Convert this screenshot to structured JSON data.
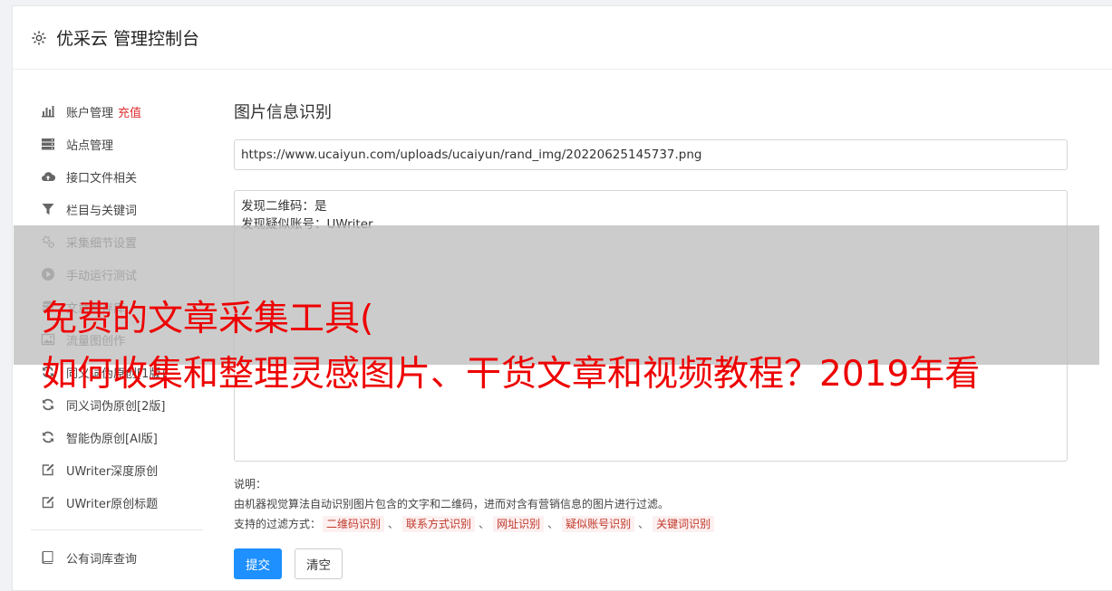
{
  "header": {
    "title": "优采云 管理控制台",
    "icon": "gear-icon"
  },
  "sidebar": {
    "items": [
      {
        "icon": "bar-chart-icon",
        "label": "账户管理",
        "badge": "充值"
      },
      {
        "icon": "server-icon",
        "label": "站点管理"
      },
      {
        "icon": "cloud-upload-icon",
        "label": "接口文件相关"
      },
      {
        "icon": "filter-icon",
        "label": "栏目与关键词"
      },
      {
        "icon": "cogs-icon",
        "label": "采集细节设置"
      },
      {
        "icon": "play-circle-icon",
        "label": "手动运行测试"
      },
      {
        "icon": "database-icon",
        "label": "文章暂存库"
      },
      {
        "icon": "image-icon",
        "label": "流量图创作"
      },
      {
        "icon": "refresh-icon",
        "label": "同义词伪原创[1版]"
      },
      {
        "icon": "refresh-icon",
        "label": "同义词伪原创[2版]"
      },
      {
        "icon": "refresh-icon",
        "label": "智能伪原创[AI版]"
      },
      {
        "icon": "edit-icon",
        "label": "UWriter深度原创"
      },
      {
        "icon": "edit-icon",
        "label": "UWriter原创标题"
      }
    ],
    "footer_items": [
      {
        "icon": "book-icon",
        "label": "公有词库查询"
      }
    ]
  },
  "main": {
    "title": "图片信息识别",
    "url_value": "https://www.ucaiyun.com/uploads/ucaiyun/rand_img/20220625145737.png",
    "result_lines": [
      "发现二维码：是",
      "发现疑似账号：UWriter"
    ],
    "note_label": "说明：",
    "note_text": "由机器视觉算法自动识别图片包含的文字和二维码，进而对含有营销信息的图片进行过滤。",
    "filter_label": "支持的过滤方式：",
    "filters": [
      "二维码识别",
      "联系方式识别",
      "网址识别",
      "疑似账号识别",
      "关键词识别"
    ],
    "separator": "、",
    "submit_label": "提交",
    "clear_label": "清空"
  },
  "overlay": {
    "line1": "免费的文章采集工具(",
    "line2": "如何收集和整理灵感图片、干货文章和视频教程？2019年看"
  },
  "colors": {
    "accent": "#1e90ff",
    "danger": "#e03030",
    "overlay_text": "#ee0000"
  }
}
